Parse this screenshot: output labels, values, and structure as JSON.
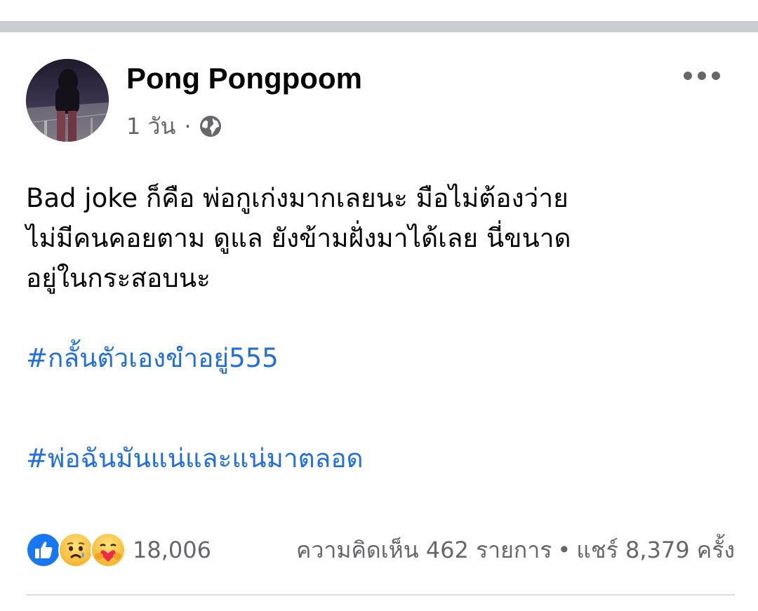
{
  "post": {
    "author": {
      "name": "Pong Pongpoom"
    },
    "meta": {
      "time": "1 วัน",
      "separator": "·",
      "privacy_icon": "globe-icon"
    },
    "body_lines": [
      "Bad joke ก็คือ พ่อกูเก่งมากเลยนะ มือไม่ต้องว่าย",
      "ไม่มีคนคอยตาม ดูแล ยังข้ามฝั่งมาได้เลย นี่ขนาด",
      "อยู่ในกระสอบนะ"
    ],
    "hashtags": [
      "#กลั้นตัวเองขำอยู่555",
      "#พ่อฉันมันแน่และแน่มาตลอด"
    ],
    "reactions": {
      "icons": [
        "like-icon",
        "sad-icon",
        "care-icon"
      ],
      "count": "18,006"
    },
    "comments_label": "ความคิดเห็น 462 รายการ",
    "stats_separator": "•",
    "shares_label": "แชร์ 8,379 ครั้ง"
  },
  "colors": {
    "hashtag": "#216fdb",
    "secondary_text": "#65676b",
    "like_blue": "#1877f2",
    "divider": "#c9ccd1"
  }
}
